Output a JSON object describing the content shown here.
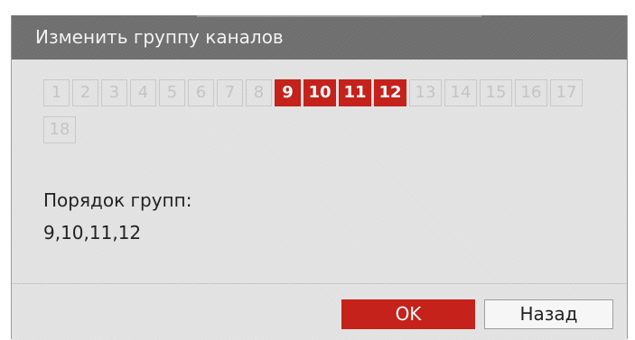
{
  "dialog": {
    "title": "Изменить группу каналов"
  },
  "channels": [
    {
      "label": "1",
      "selected": false
    },
    {
      "label": "2",
      "selected": false
    },
    {
      "label": "3",
      "selected": false
    },
    {
      "label": "4",
      "selected": false
    },
    {
      "label": "5",
      "selected": false
    },
    {
      "label": "6",
      "selected": false
    },
    {
      "label": "7",
      "selected": false
    },
    {
      "label": "8",
      "selected": false
    },
    {
      "label": "9",
      "selected": true
    },
    {
      "label": "10",
      "selected": true
    },
    {
      "label": "11",
      "selected": true
    },
    {
      "label": "12",
      "selected": true
    },
    {
      "label": "13",
      "selected": false
    },
    {
      "label": "14",
      "selected": false
    },
    {
      "label": "15",
      "selected": false
    },
    {
      "label": "16",
      "selected": false
    },
    {
      "label": "17",
      "selected": false
    },
    {
      "label": "18",
      "selected": false
    }
  ],
  "group_order": {
    "label": "Порядок групп:",
    "value": "9,10,11,12"
  },
  "buttons": {
    "ok_label": "OK",
    "back_label": "Назад"
  },
  "colors": {
    "accent": "#c4221b",
    "title_bar": "#6e6e6e",
    "panel": "#e4e4e4"
  }
}
